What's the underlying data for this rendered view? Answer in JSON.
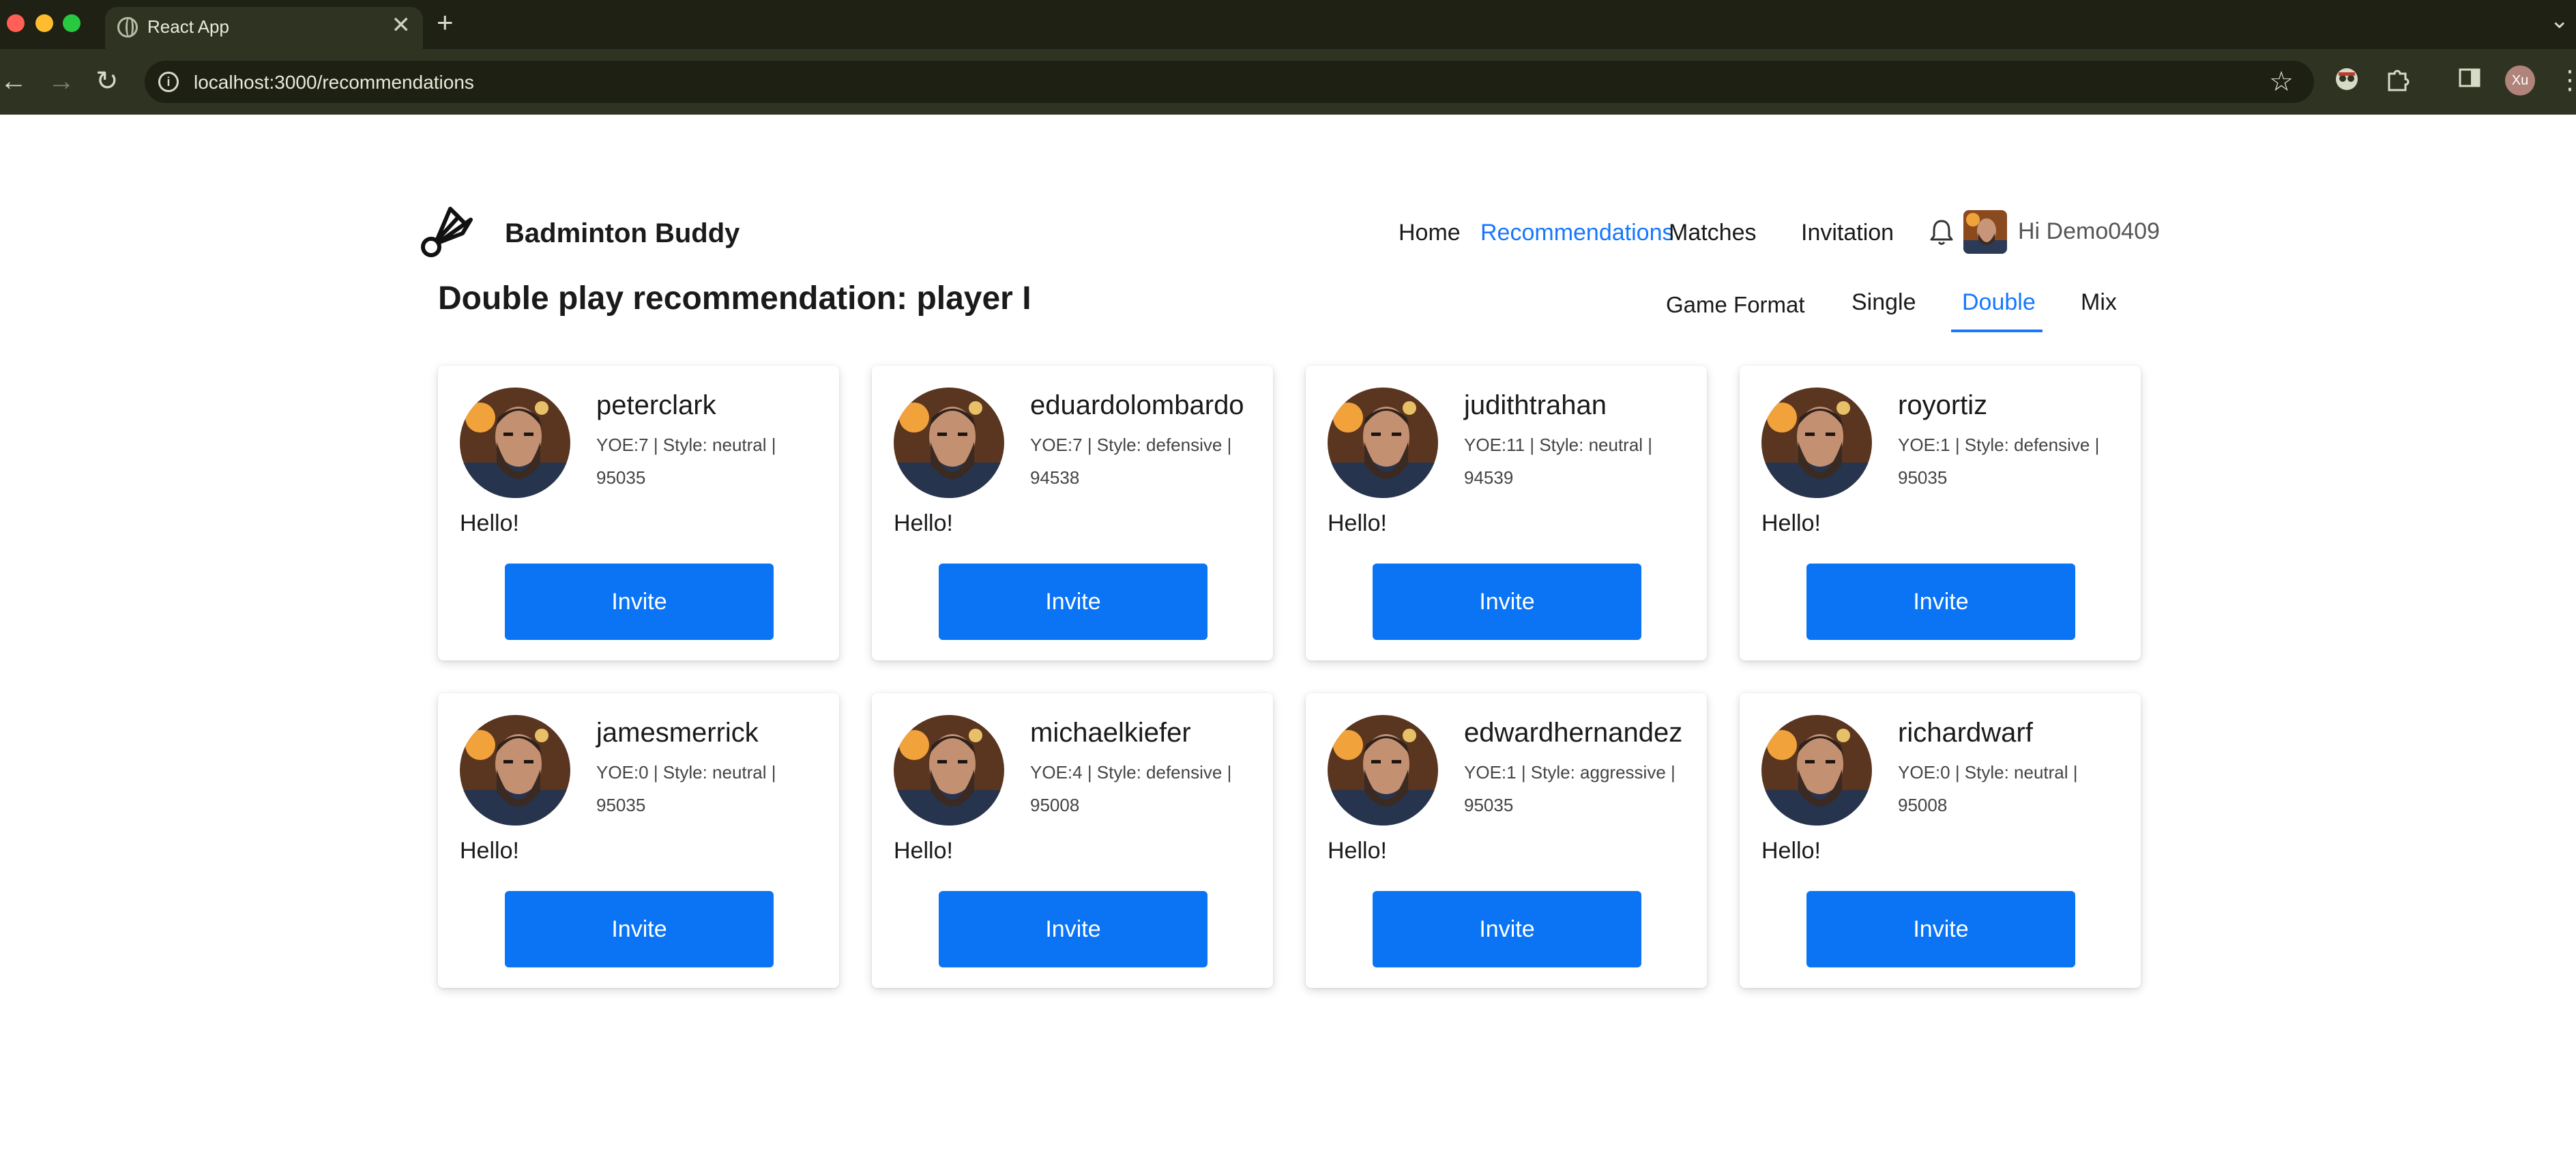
{
  "browser": {
    "tab_title": "React App",
    "tab_close": "✕",
    "new_tab": "+",
    "url": "localhost:3000/recommendations",
    "profile_initials": "Xu"
  },
  "app": {
    "brand": "Badminton Buddy",
    "nav": {
      "home": "Home",
      "recommendations": "Recommendations",
      "matches": "Matches",
      "invitation": "Invitation"
    },
    "greeting": "Hi Demo0409"
  },
  "page": {
    "title": "Double play recommendation: player I",
    "format_label": "Game Format",
    "formats": [
      "Single",
      "Double",
      "Mix"
    ],
    "active_format": "Double"
  },
  "players": [
    {
      "name": "peterclark",
      "meta": "YOE:7 | Style: neutral | 95035",
      "message": "Hello!",
      "button": "Invite"
    },
    {
      "name": "eduardolombardo",
      "meta": "YOE:7 | Style: defensive | 94538",
      "message": "Hello!",
      "button": "Invite"
    },
    {
      "name": "judithtrahan",
      "meta": "YOE:11 | Style: neutral | 94539",
      "message": "Hello!",
      "button": "Invite"
    },
    {
      "name": "royortiz",
      "meta": "YOE:1 | Style: defensive | 95035",
      "message": "Hello!",
      "button": "Invite"
    },
    {
      "name": "jamesmerrick",
      "meta": "YOE:0 | Style: neutral | 95035",
      "message": "Hello!",
      "button": "Invite"
    },
    {
      "name": "michaelkiefer",
      "meta": "YOE:4 | Style: defensive | 95008",
      "message": "Hello!",
      "button": "Invite"
    },
    {
      "name": "edwardhernandez",
      "meta": "YOE:1 | Style: aggressive | 95035",
      "message": "Hello!",
      "button": "Invite"
    },
    {
      "name": "richardwarf",
      "meta": "YOE:0 | Style: neutral | 95008",
      "message": "Hello!",
      "button": "Invite"
    }
  ],
  "colors": {
    "accent": "#1677ff",
    "button": "#0b74f5",
    "chrome_dark": "#1e2113",
    "chrome_toolbar": "#2f3321"
  },
  "icons": [
    "back-arrow-icon",
    "forward-arrow-icon",
    "reload-icon",
    "site-info-icon",
    "star-icon",
    "extension-icon",
    "puzzle-icon",
    "sidebar-icon",
    "menu-icon",
    "shuttlecock-logo",
    "bell-icon"
  ]
}
